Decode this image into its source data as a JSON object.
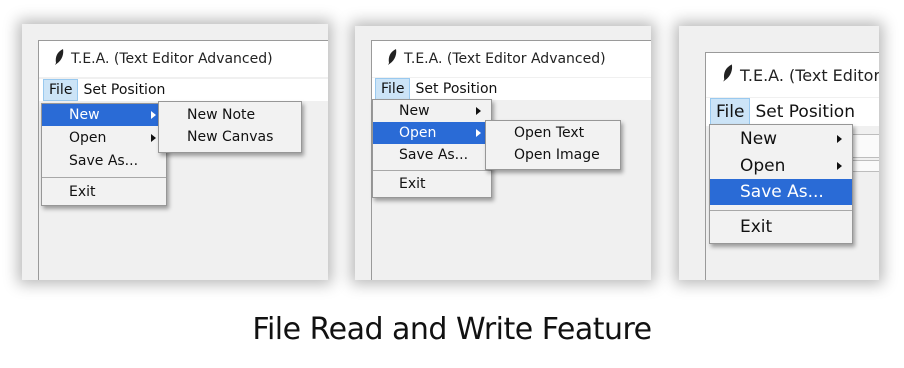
{
  "app": {
    "title": "T.E.A. (Text Editor Advanced)"
  },
  "menubar": {
    "file": "File",
    "set_position": "Set Position"
  },
  "file_menu": {
    "new": "New",
    "open": "Open",
    "save_as": "Save As...",
    "exit": "Exit"
  },
  "new_submenu": {
    "note": "New Note",
    "canvas": "New Canvas"
  },
  "open_submenu": {
    "text": "Open Text",
    "image": "Open Image"
  },
  "caption": "File Read and Write Feature",
  "icons": {
    "app": "quill-icon",
    "submenu": "triangle-right-icon"
  },
  "colors": {
    "highlight": "#2a6bd6",
    "menubar_active": "#cce4f7",
    "menu_bg": "#f2f2f2"
  },
  "state": {
    "panel_1": {
      "highlighted": "New",
      "submenu_open": "New"
    },
    "panel_2": {
      "highlighted": "Open",
      "submenu_open": "Open"
    },
    "panel_3": {
      "highlighted": "Save As..."
    }
  }
}
